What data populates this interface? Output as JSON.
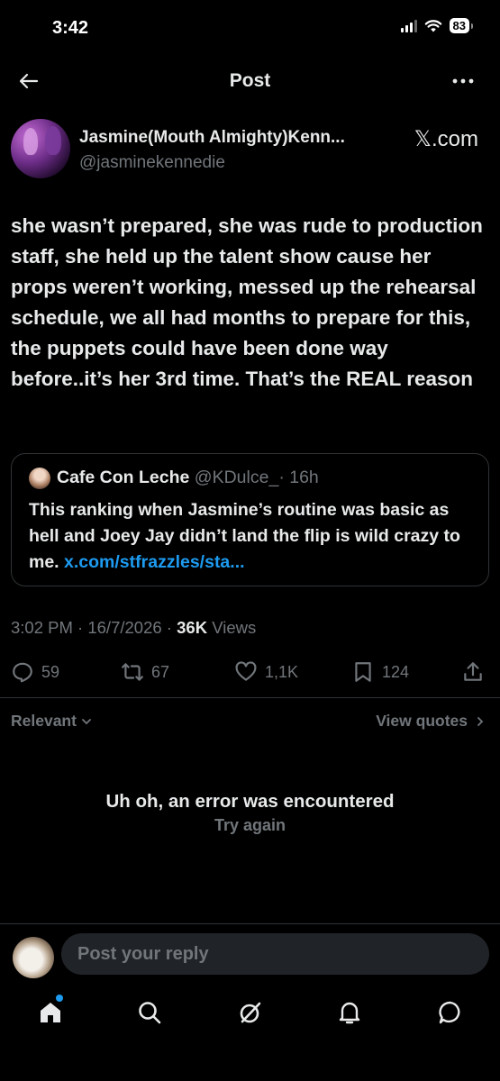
{
  "status_bar": {
    "time": "3:42",
    "battery": "83"
  },
  "header": {
    "title": "Post"
  },
  "author": {
    "name": "Jasmine(Mouth Almighty)Kenn...",
    "handle": "@jasminekennedie",
    "source": "𝕏.com"
  },
  "post": {
    "text": "she wasn’t prepared, she was rude to production staff, she held up the talent show cause her props weren’t working, messed up the rehearsal schedule, we all had months to prepare for this, the puppets could have been done way before..it’s her 3rd time. That’s the REAL reason"
  },
  "quote": {
    "name": "Cafe Con Leche",
    "handle": "@KDulce_",
    "time": "· 16h",
    "text": "This ranking when Jasmine’s routine was basic as hell and Joey Jay didn’t land the flip is wild crazy to me. ",
    "link": "x.com/stfrazzles/sta..."
  },
  "meta": {
    "time": "3:02 PM",
    "date": "16/7/2026",
    "views_count": "36K",
    "views_label": "Views"
  },
  "actions": {
    "replies": "59",
    "reposts": "67",
    "likes": "1,1K",
    "bookmarks": "124"
  },
  "filters": {
    "relevant": "Relevant",
    "view_quotes": "View quotes"
  },
  "error": {
    "title": "Uh oh, an error was encountered",
    "retry": "Try again"
  },
  "reply": {
    "placeholder": "Post your reply"
  },
  "colors": {
    "background": "#000000",
    "accent": "#1d9bf0",
    "muted": "#71767b",
    "text": "#e7e9ea"
  }
}
